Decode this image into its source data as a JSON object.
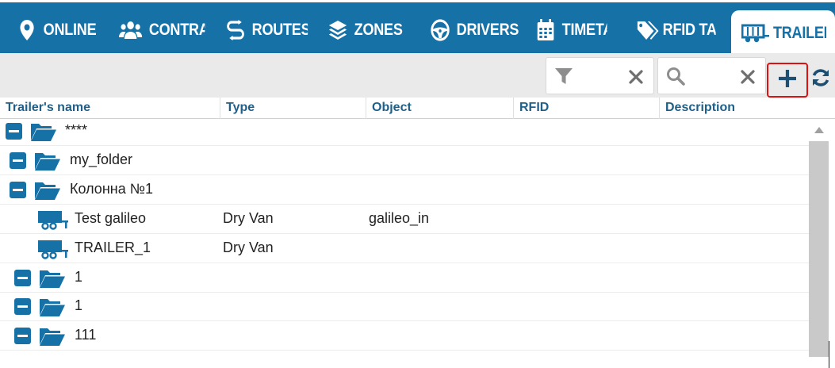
{
  "tabs": [
    {
      "label": "ONLINE",
      "icon": "map-pin-icon"
    },
    {
      "label": "CONTRACTORS",
      "icon": "users-icon"
    },
    {
      "label": "ROUTES",
      "icon": "routes-icon"
    },
    {
      "label": "ZONES",
      "icon": "layers-icon"
    },
    {
      "label": "DRIVERS",
      "icon": "steering-wheel-icon"
    },
    {
      "label": "TIMETABLES",
      "icon": "calendar-icon"
    },
    {
      "label": "RFID TAGS",
      "icon": "tag-icon"
    },
    {
      "label": "TRAILERS",
      "icon": "trailer-icon",
      "active": true
    }
  ],
  "toolbar": {
    "filter_value": "",
    "search_value": "",
    "add_label": "+",
    "icons": [
      "filter-icon",
      "clear-icon",
      "search-icon",
      "plus-icon",
      "refresh-icon"
    ]
  },
  "columns": [
    "Trailer's name",
    "Type",
    "Object",
    "RFID",
    "Description"
  ],
  "rows": [
    {
      "kind": "folder",
      "name": "****",
      "type": "",
      "object": ""
    },
    {
      "kind": "folder",
      "name": "my_folder",
      "type": "",
      "object": ""
    },
    {
      "kind": "folder",
      "name": "Колонна №1",
      "type": "",
      "object": ""
    },
    {
      "kind": "trailer",
      "name": "Test galileo",
      "type": "Dry Van",
      "object": "galileo_in"
    },
    {
      "kind": "trailer",
      "name": "TRAILER_1",
      "type": "Dry Van",
      "object": ""
    },
    {
      "kind": "folder",
      "name": "1",
      "type": "",
      "object": ""
    },
    {
      "kind": "folder",
      "name": "1",
      "type": "",
      "object": ""
    },
    {
      "kind": "folder",
      "name": "111",
      "type": "",
      "object": ""
    }
  ],
  "colors": {
    "primary": "#1671a7",
    "highlight": "#e01010",
    "toolbar": "#eaeaea",
    "scrollbar": "#c9c9c9"
  }
}
